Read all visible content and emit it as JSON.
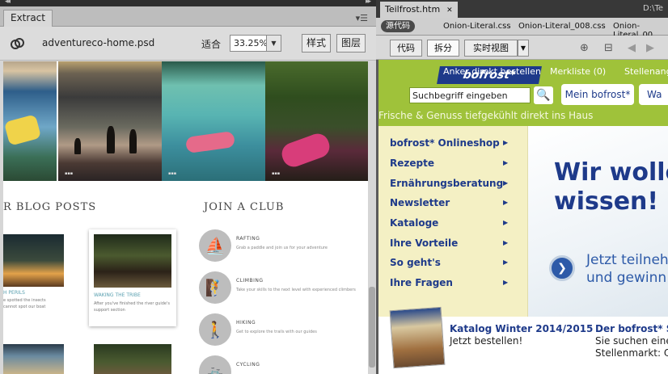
{
  "extract": {
    "tab": "Extract",
    "file": "adventureco-home.psd",
    "fit_label": "适合",
    "zoom": "33.25%",
    "style_btn": "样式",
    "layer_btn": "图层",
    "heading_blog": "R BLOG POSTS",
    "heading_club": "JOIN A CLUB",
    "blog1_title": "H PERILS",
    "blog1_desc": "e spotted the insects cannot spot our boat",
    "card_title": "WAKING THE TRIBE",
    "card_desc": "After you've finished the river guide's support section",
    "clubs": [
      {
        "title": "RAFTING",
        "desc": "Grab a paddle and join us for your adventure"
      },
      {
        "title": "CLIMBING",
        "desc": "Take your skills to the next level with experienced climbers"
      },
      {
        "title": "HIKING",
        "desc": "Get to explore the trails with our guides"
      },
      {
        "title": "CYCLING",
        "desc": ""
      }
    ]
  },
  "dw": {
    "active_tab": "Teilfrost.htm",
    "path": "D:\\Te",
    "source_pill": "源代码",
    "related_files": [
      "Onion-Literal.css",
      "Onion-Literal_008.css",
      "Onion-Literal_00"
    ],
    "view_code": "代码",
    "view_split": "拆分",
    "view_live": "实时视图"
  },
  "site": {
    "top_link1": "Anker direkt bestellen",
    "top_link2": "Merkliste (0)",
    "top_link3": "Stellenang",
    "logo": "bofrost*",
    "search_placeholder": "Suchbegriff eingeben",
    "btn_mein": "Mein bofrost*",
    "btn_war": "Wa",
    "tagline": "Frische & Genuss   tiefgekühlt direkt ins Haus",
    "nav": [
      "bofrost* Onlineshop",
      "Rezepte",
      "Ernährungsberatung",
      "Newsletter",
      "Kataloge",
      "Ihre Vorteile",
      "So geht's",
      "Ihre Fragen"
    ],
    "hero_title_line1": "Wir wolle",
    "hero_title_line2": "wissen!",
    "hero_sub_line1": "Jetzt teilneh",
    "hero_sub_line2": "und gewinn",
    "catalog_title": "Katalog Winter 2014/2015",
    "catalog_sub": "Jetzt bestellen!",
    "job_title": "Der bofrost* Stell",
    "job_sub_line1": "Sie suchen eine ne",
    "job_sub_line2": "Stellenmarkt: Off"
  }
}
